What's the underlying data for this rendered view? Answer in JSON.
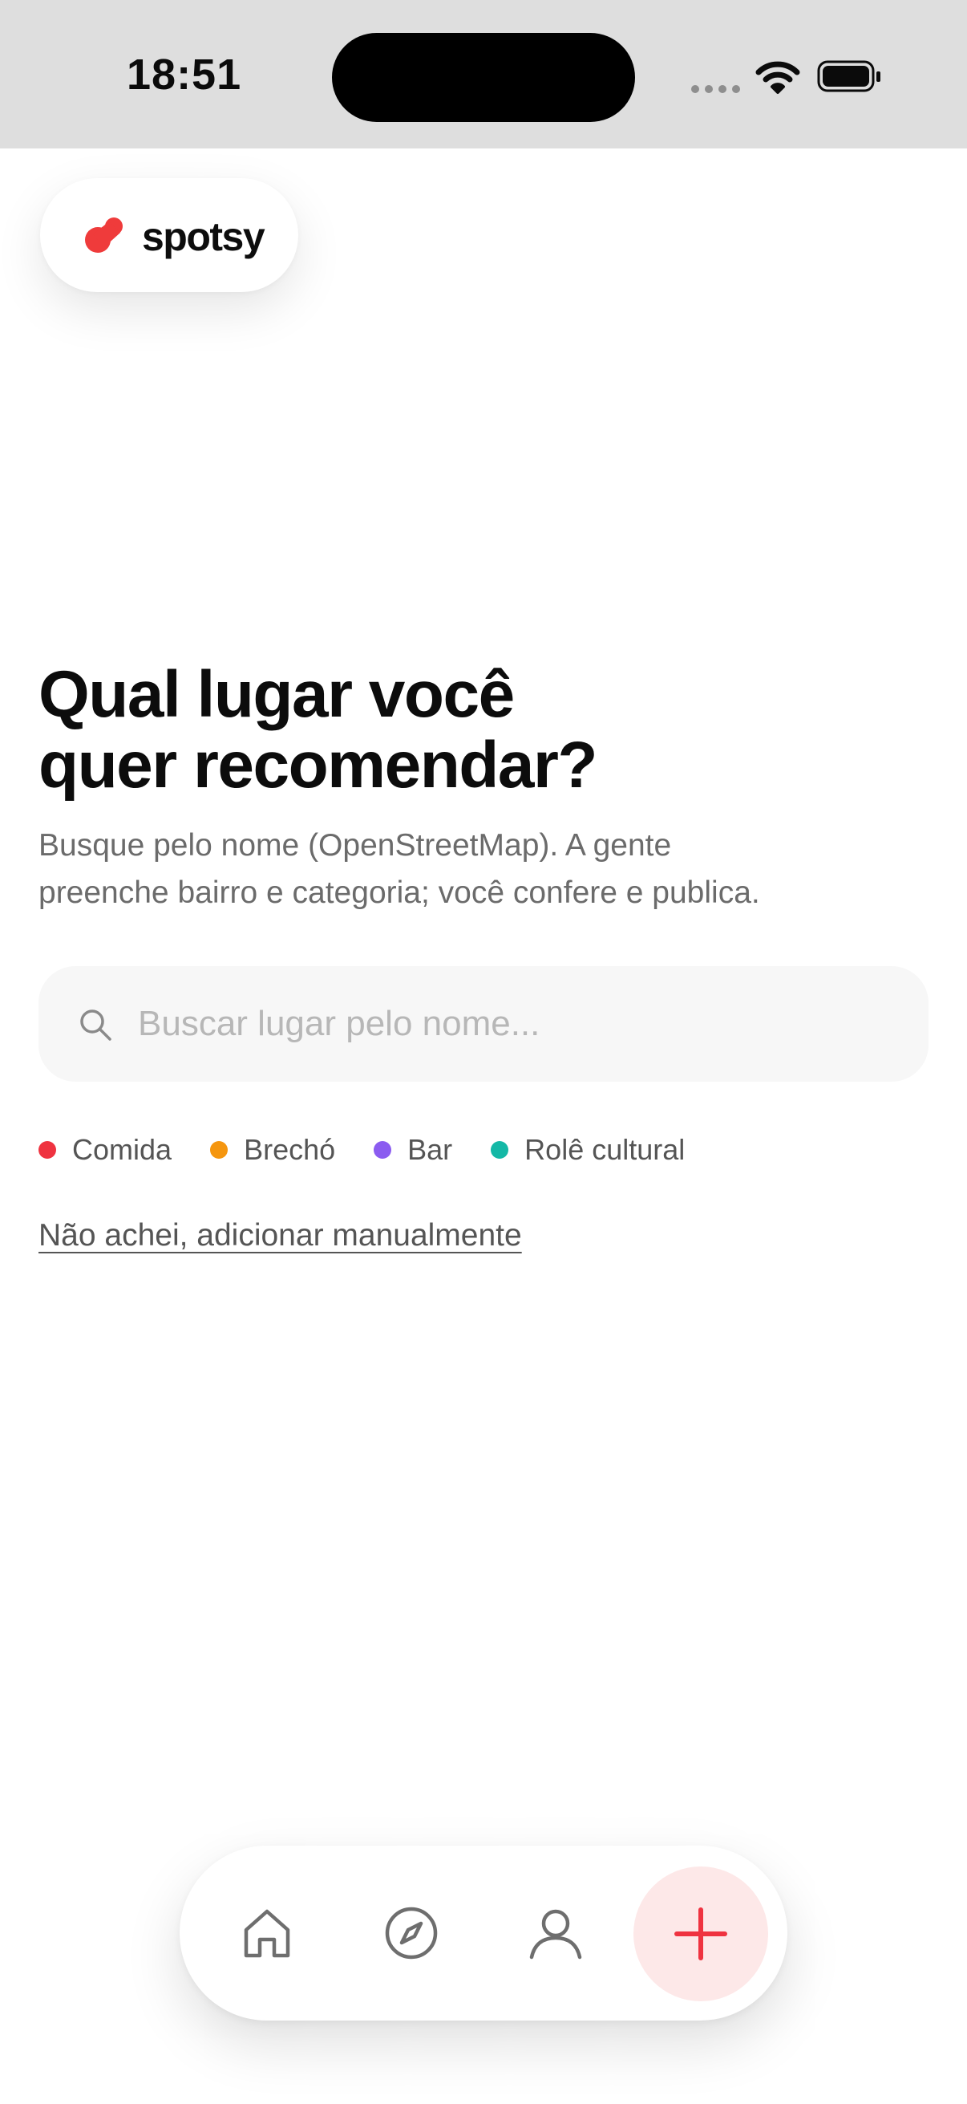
{
  "status_bar": {
    "time": "18:51"
  },
  "brand": {
    "name": "spotsy",
    "accent_color": "#ef3b3b"
  },
  "main": {
    "title_line1": "Qual lugar você",
    "title_line2": "quer recomendar?",
    "subtitle_line1": "Busque pelo nome (OpenStreetMap). A gente",
    "subtitle_line2": "preenche bairro e categoria; você confere e publica."
  },
  "search": {
    "placeholder": "Buscar lugar pelo nome...",
    "value": "",
    "icon": "search-icon"
  },
  "categories": [
    {
      "label": "Comida",
      "color": "#ef3340"
    },
    {
      "label": "Brechó",
      "color": "#f5960f"
    },
    {
      "label": "Bar",
      "color": "#8b5cf0"
    },
    {
      "label": "Rolê cultural",
      "color": "#14b8a6"
    }
  ],
  "manual_link": {
    "label": "Não achei, adicionar manualmente"
  },
  "bottom_nav": {
    "items": [
      {
        "icon": "home-icon"
      },
      {
        "icon": "compass-icon"
      },
      {
        "icon": "user-icon"
      },
      {
        "icon": "plus-icon",
        "active": true
      }
    ],
    "active_bg": "#fde8e8",
    "active_color": "#ef3340"
  }
}
